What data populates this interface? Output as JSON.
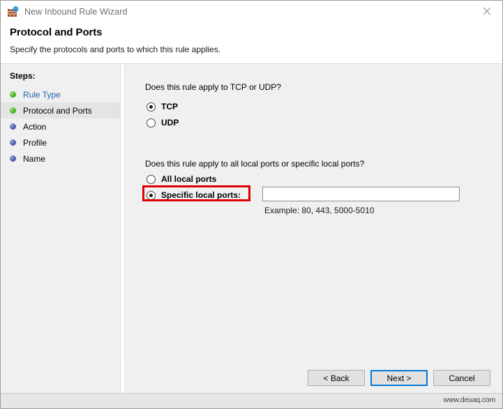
{
  "window": {
    "title": "New Inbound Rule Wizard",
    "icon": "firewall-brick-globe-icon",
    "close_label": "✕"
  },
  "header": {
    "title": "Protocol and Ports",
    "subtitle": "Specify the protocols and ports to which this rule applies."
  },
  "sidebar": {
    "label": "Steps:",
    "items": [
      {
        "label": "Rule Type",
        "state": "done",
        "current": false,
        "link": true
      },
      {
        "label": "Protocol and Ports",
        "state": "done",
        "current": true,
        "link": false
      },
      {
        "label": "Action",
        "state": "todo",
        "current": false,
        "link": false
      },
      {
        "label": "Profile",
        "state": "todo",
        "current": false,
        "link": false
      },
      {
        "label": "Name",
        "state": "todo",
        "current": false,
        "link": false
      }
    ]
  },
  "main": {
    "question_protocol": "Does this rule apply to TCP or UDP?",
    "option_tcp": "TCP",
    "option_udp": "UDP",
    "question_ports": "Does this rule apply to all local ports or specific local ports?",
    "option_all_ports": "All local ports",
    "option_specific_ports": "Specific local ports:",
    "ports_value": "",
    "ports_placeholder": "",
    "example_text": "Example: 80, 443, 5000-5010",
    "selected_protocol": "TCP",
    "selected_port_scope": "Specific local ports:",
    "highlight_color": "#e00000",
    "focus_color": "#0078d7"
  },
  "buttons": {
    "back": "< Back",
    "next": "Next >",
    "cancel": "Cancel"
  },
  "footer": {
    "watermark": "www.deuaq.com"
  }
}
